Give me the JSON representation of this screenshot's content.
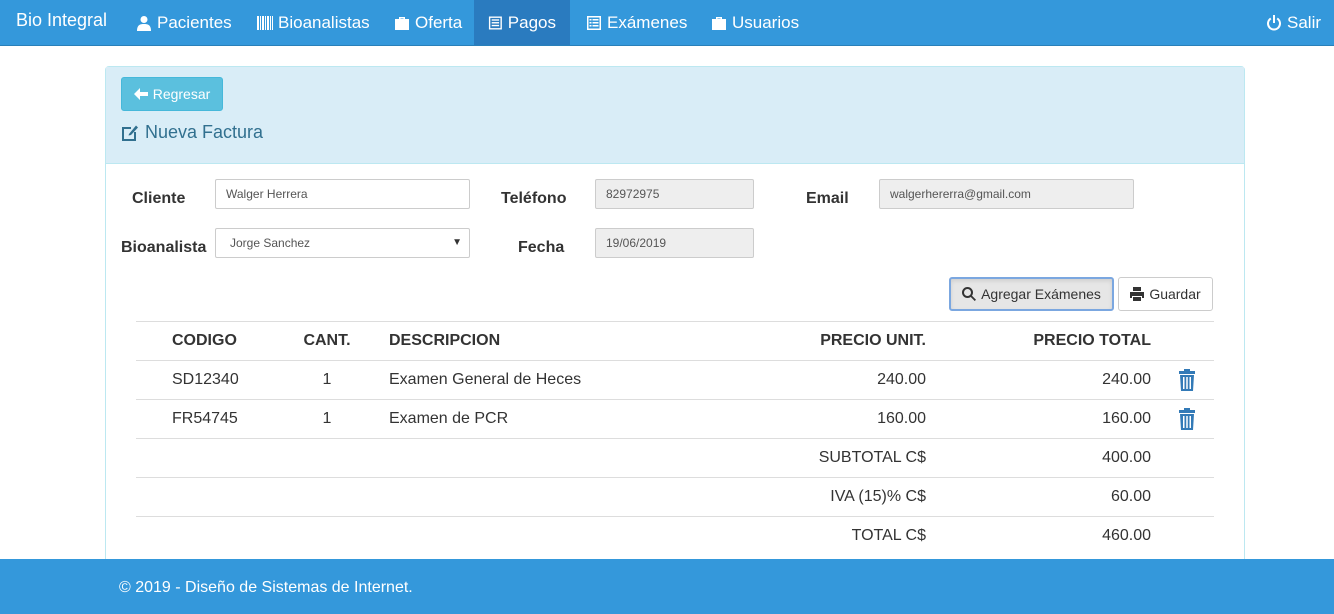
{
  "navbar": {
    "brand": "Bio Integral",
    "items": [
      {
        "label": "Pacientes",
        "icon": "user-icon"
      },
      {
        "label": "Bioanalistas",
        "icon": "barcode-icon"
      },
      {
        "label": "Oferta",
        "icon": "briefcase-icon"
      },
      {
        "label": "Pagos",
        "icon": "list-alt-icon",
        "active": true
      },
      {
        "label": "Exámenes",
        "icon": "list-icon"
      },
      {
        "label": "Usuarios",
        "icon": "briefcase-icon"
      }
    ],
    "logout": "Salir"
  },
  "panel": {
    "back_label": "Regresar",
    "title": "Nueva Factura"
  },
  "form": {
    "cliente_label": "Cliente",
    "cliente_value": "Walger Herrera",
    "telefono_label": "Teléfono",
    "telefono_value": "82972975",
    "email_label": "Email",
    "email_value": "walgerhererra@gmail.com",
    "bioanalista_label": "Bioanalista",
    "bioanalista_value": "Jorge Sanchez",
    "fecha_label": "Fecha",
    "fecha_value": "19/06/2019"
  },
  "actions": {
    "add_exams": "Agregar Exámenes",
    "save": "Guardar"
  },
  "table": {
    "headers": {
      "code": "CODIGO",
      "qty": "CANT.",
      "desc": "DESCRIPCION",
      "unit": "PRECIO UNIT.",
      "total": "PRECIO TOTAL"
    },
    "rows": [
      {
        "code": "SD12340",
        "qty": "1",
        "desc": "Examen General de Heces",
        "unit": "240.00",
        "total": "240.00"
      },
      {
        "code": "FR54745",
        "qty": "1",
        "desc": "Examen de PCR",
        "unit": "160.00",
        "total": "160.00"
      }
    ],
    "summary": [
      {
        "label": "SUBTOTAL C$",
        "value": "400.00"
      },
      {
        "label": "IVA (15)% C$",
        "value": "60.00"
      },
      {
        "label": "TOTAL C$",
        "value": "460.00"
      }
    ]
  },
  "footer": {
    "text": "© 2019 - Diseño de Sistemas de Internet."
  },
  "colors": {
    "navbar": "#3498db",
    "nav_active": "#2a7bbf",
    "panel_heading": "#d9edf7",
    "info_button": "#5bc0de",
    "trash_icon": "#337ab7"
  }
}
